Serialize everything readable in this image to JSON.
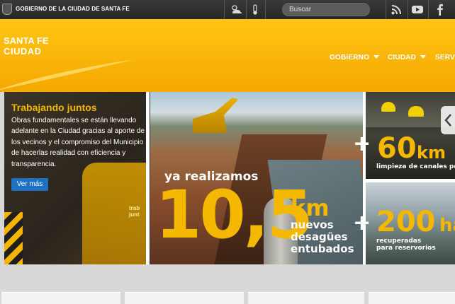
{
  "topbar": {
    "government": "GOBIERNO DE LA CIUDAD DE SANTA FE",
    "search_placeholder": "Buscar",
    "icons": [
      "weather-icon",
      "temperature-icon",
      "rss-icon",
      "youtube-icon",
      "facebook-icon"
    ]
  },
  "header": {
    "logo_line1": "SANTA FE",
    "logo_line2": "CIUDAD",
    "nav": [
      {
        "label": "GOBIERNO"
      },
      {
        "label": "CIUDAD"
      },
      {
        "label": "SERV"
      }
    ]
  },
  "feature": {
    "title": "Trabajando juntos",
    "body": "Obras fundamentales se están llevando adelante en la Ciudad gracias al aporte de los vecinos y el compromiso del Municipio de hacerlas realidad con eficiencia y transparencia.",
    "button": "Ver más",
    "vest_text": "trab\njunt"
  },
  "stats": {
    "lead": "ya realizamos",
    "main_value": "10,5",
    "main_unit": "km",
    "main_desc": "nuevos\ndesagües\nentubados",
    "plus": "+",
    "stat2_value": "60",
    "stat2_unit": "km",
    "stat2_desc": "limpieza de canales por",
    "stat3_value": "200",
    "stat3_unit": "ha",
    "stat3_desc": "recuperadas\npara reservorios"
  },
  "colors": {
    "brand_yellow": "#f5b800",
    "topbar": "#2e2e2e",
    "button_blue": "#1f6fc3"
  }
}
